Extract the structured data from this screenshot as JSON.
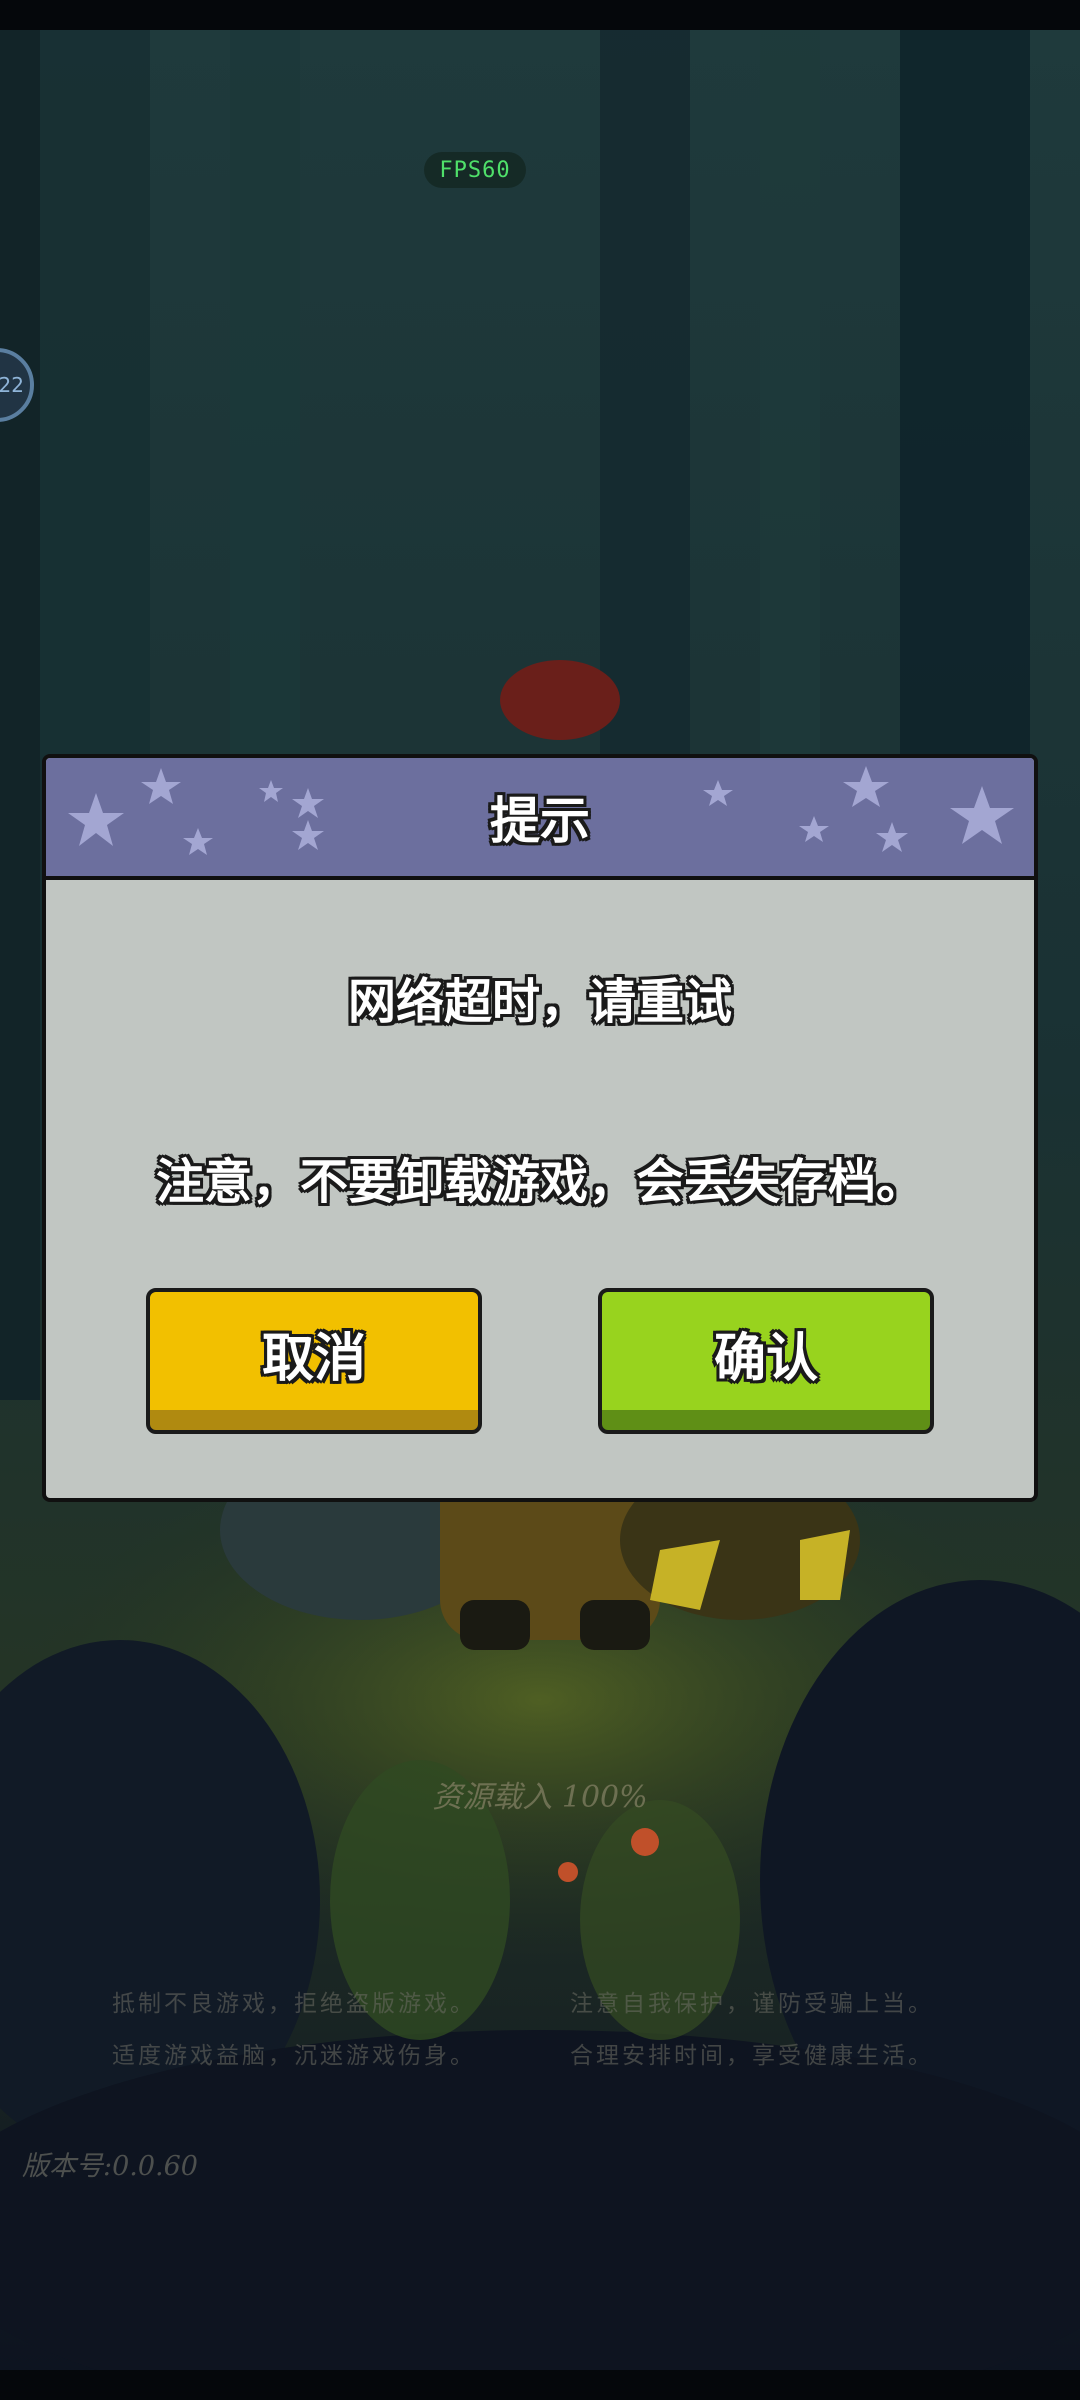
{
  "hud": {
    "fps_label": "FPS60",
    "side_badge": "22"
  },
  "loading": {
    "progress_text": "资源载入 100%"
  },
  "notices": {
    "line1_left": "抵制不良游戏，拒绝盗版游戏。",
    "line1_right": "注意自我保护，谨防受骗上当。",
    "line2_left": "适度游戏益脑，沉迷游戏伤身。",
    "line2_right": "合理安排时间，享受健康生活。"
  },
  "version_label": "版本号:0.0.60",
  "dialog": {
    "title": "提示",
    "message": "网络超时，请重试",
    "warning": "注意，不要卸载游戏，会丢失存档。",
    "cancel_label": "取消",
    "confirm_label": "确认"
  },
  "colors": {
    "dialog_body": "#c1c6c2",
    "dialog_header": "#6c6f9e",
    "cancel_button": "#f2c000",
    "confirm_button": "#98d31e"
  }
}
